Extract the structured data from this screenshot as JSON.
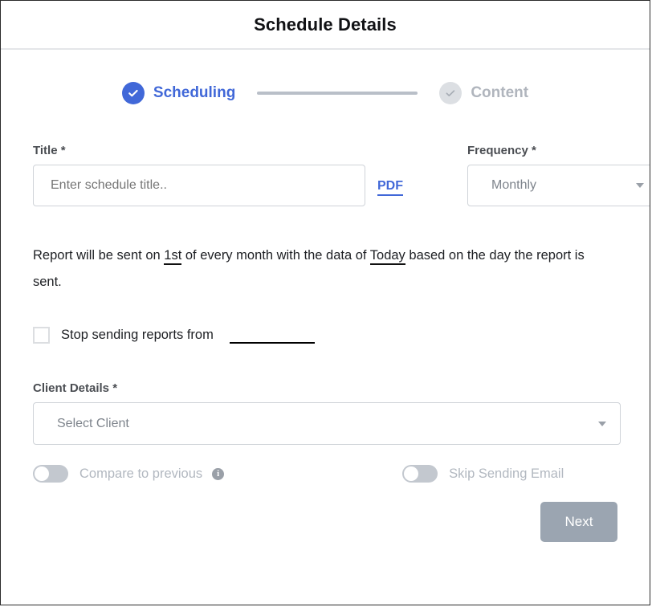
{
  "header": {
    "title": "Schedule Details"
  },
  "stepper": {
    "steps": [
      {
        "label": "Scheduling",
        "state": "active",
        "icon": "check-icon"
      },
      {
        "label": "Content",
        "state": "inactive",
        "icon": "check-icon"
      }
    ]
  },
  "form": {
    "title": {
      "label": "Title *",
      "value": "",
      "placeholder": "Enter schedule title.."
    },
    "format_link": {
      "label": "PDF"
    },
    "frequency": {
      "label": "Frequency *",
      "value": "Monthly"
    },
    "description": {
      "part1": "Report will be sent on ",
      "day_value": "1st",
      "part2": " of every month with the data of ",
      "data_value": "Today",
      "part3": " based on the day the report is sent."
    },
    "stop_sending": {
      "label": "Stop sending reports from",
      "checked": "false",
      "date_value": ""
    },
    "client_details": {
      "label": "Client Details *",
      "value": "Select Client"
    },
    "compare_toggle": {
      "label": "Compare to previous",
      "state": "off",
      "info_icon": "info-icon",
      "info_glyph": "i"
    },
    "skip_email_toggle": {
      "label": "Skip Sending Email",
      "state": "off"
    }
  },
  "footer": {
    "next_label": "Next"
  },
  "colors": {
    "accent": "#4168d8",
    "inactive": "#b0b5bd",
    "step_inactive_bg": "#dcdfe3",
    "border": "#cfd3d8",
    "button_disabled": "#9ba5b1",
    "text": "#1d1f23"
  }
}
